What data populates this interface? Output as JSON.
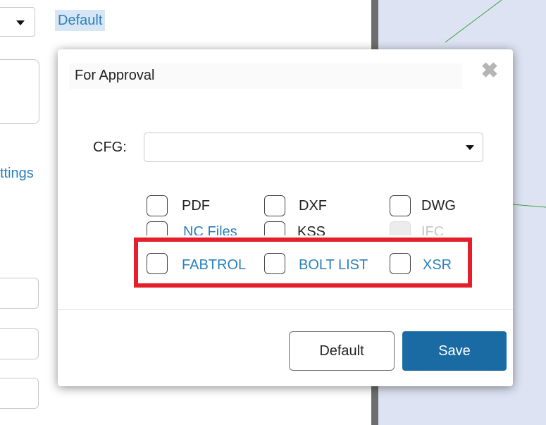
{
  "background": {
    "default_link": "Default",
    "settings_link": "ttings"
  },
  "dialog": {
    "title": "For Approval",
    "close_icon": "close-icon",
    "cfg_label": "CFG:",
    "cfg_value": "",
    "checkboxes": {
      "pdf": {
        "label": "PDF",
        "checked": false
      },
      "dxf": {
        "label": "DXF",
        "checked": false
      },
      "dwg": {
        "label": "DWG",
        "checked": false
      },
      "nc_files": {
        "label": "NC Files",
        "checked": false
      },
      "kss": {
        "label": "KSS",
        "checked": false
      },
      "ifc": {
        "label": "IFC",
        "checked": false,
        "disabled": true
      },
      "fabtrol": {
        "label": "FABTROL",
        "checked": false
      },
      "bolt_list": {
        "label": "BOLT LIST",
        "checked": false
      },
      "xsr": {
        "label": "XSR",
        "checked": false
      }
    },
    "buttons": {
      "default_label": "Default",
      "save_label": "Save"
    }
  },
  "colors": {
    "link_blue": "#2980b9",
    "save_blue": "#1a6aa3",
    "highlight_red": "#e41e2b"
  }
}
